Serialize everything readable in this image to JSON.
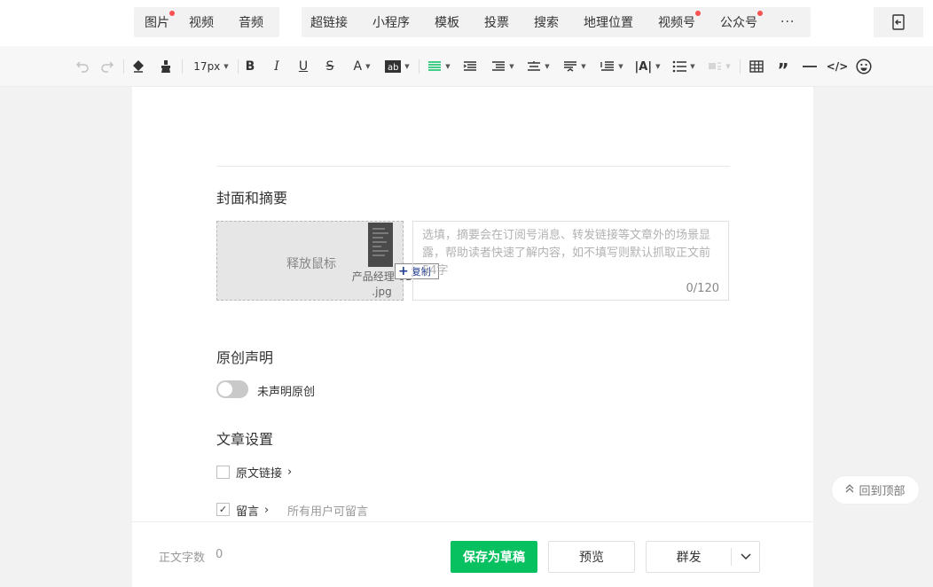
{
  "media_group": {
    "items": [
      {
        "label": "图片",
        "dot": true
      },
      {
        "label": "视频",
        "dot": false
      },
      {
        "label": "音频",
        "dot": false
      }
    ]
  },
  "insert_group": {
    "items": [
      {
        "label": "超链接",
        "dot": false
      },
      {
        "label": "小程序",
        "dot": false
      },
      {
        "label": "模板",
        "dot": false
      },
      {
        "label": "投票",
        "dot": false
      },
      {
        "label": "搜索",
        "dot": false
      },
      {
        "label": "地理位置",
        "dot": false
      },
      {
        "label": "视频号",
        "dot": true
      },
      {
        "label": "公众号",
        "dot": true
      }
    ],
    "more": "···"
  },
  "toolbar": {
    "font_size": "17px"
  },
  "cover_section": {
    "title": "封面和摘要",
    "drop_hint": "释放鼠标",
    "file_name_line1": "产品经理-01",
    "file_name_line2": ".jpg",
    "copy_label": "复制",
    "digest_placeholder": "选填，摘要会在订阅号消息、转发链接等文章外的场景显露，帮助读者快速了解内容，如不填写则默认抓取正文前54字",
    "digest_count": "0/120"
  },
  "original_section": {
    "title": "原创声明",
    "toggle_label": "未声明原创"
  },
  "settings_section": {
    "title": "文章设置",
    "source_link_label": "原文链接",
    "comment_label": "留言",
    "comment_value": "所有用户可留言"
  },
  "footer": {
    "word_count_label": "正文字数",
    "word_count_value": "0",
    "save_label": "保存为草稿",
    "preview_label": "预览",
    "mass_send_label": "群发"
  },
  "back_to_top": "回到顶部",
  "colors": {
    "primary_green": "#07c160",
    "dot_red": "#fa5151",
    "link_blue": "#1e3c8c"
  }
}
